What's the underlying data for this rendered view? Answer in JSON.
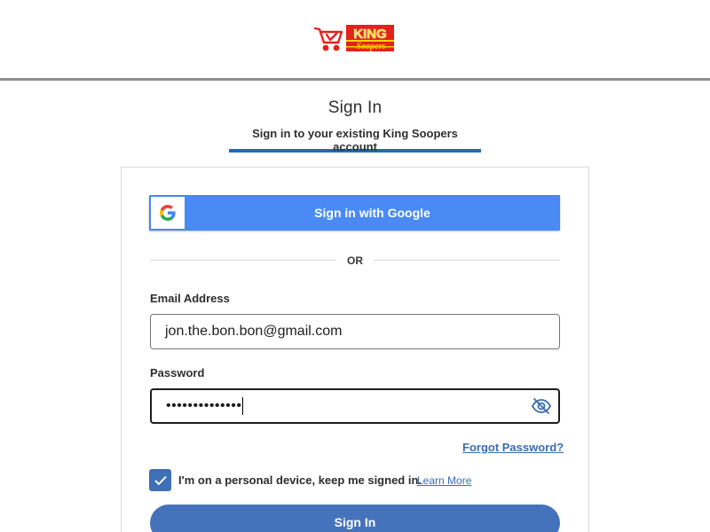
{
  "header": {
    "logo_text_top": "KING",
    "logo_text_bottom": "Soopers",
    "brand_color": "#e2231a",
    "brand_accent": "#ffd200"
  },
  "page": {
    "title": "Sign In",
    "tab_label": "Sign in to your existing King Soopers account"
  },
  "google": {
    "label": "Sign in with Google",
    "icon": "google-g-icon",
    "color": "#4285f4"
  },
  "divider": {
    "text": "OR"
  },
  "email": {
    "label": "Email Address",
    "value": "jon.the.bon.bon@gmail.com"
  },
  "password": {
    "label": "Password",
    "masked_value": "••••••••••••••",
    "toggle_icon": "eye-slash-icon"
  },
  "forgot": {
    "label": "Forgot Password?"
  },
  "remember": {
    "checked": true,
    "label": "I'm on a personal device, keep me signed in.",
    "learn_more": "Learn More"
  },
  "submit": {
    "label": "Sign In",
    "color": "#4473bb"
  }
}
